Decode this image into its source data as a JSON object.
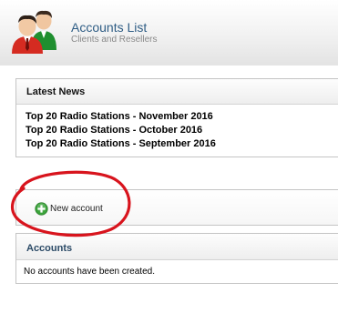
{
  "header": {
    "title": "Accounts List",
    "subtitle": "Clients and Resellers",
    "icon": "users-icon"
  },
  "latest_news": {
    "title": "Latest News",
    "items": [
      "Top 20 Radio Stations - November 2016",
      "Top 20 Radio Stations - October 2016",
      "Top 20 Radio Stations - September 2016"
    ]
  },
  "toolbar": {
    "new_account_label": "New account",
    "new_account_icon": "plus-circle-icon"
  },
  "accounts": {
    "title": "Accounts",
    "empty_message": "No accounts have been created."
  },
  "colors": {
    "title": "#2f5d85",
    "plus_icon": "#3aa33a",
    "annotation": "#d8141d"
  }
}
